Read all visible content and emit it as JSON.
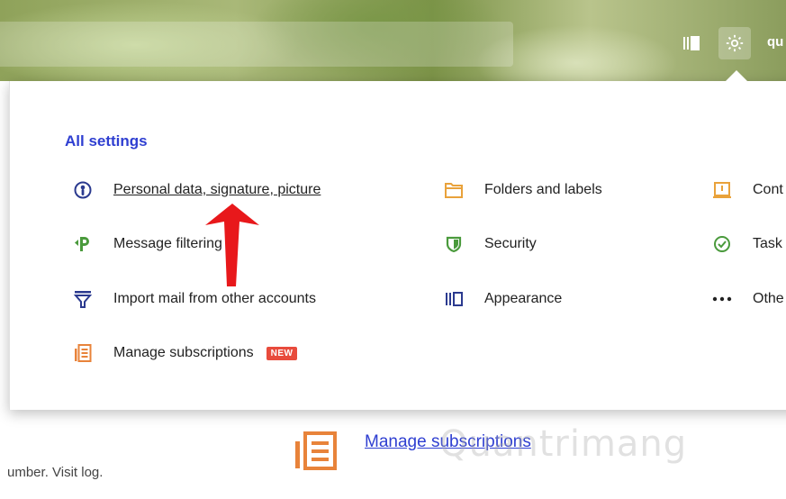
{
  "header": {
    "user_label": "qu"
  },
  "panel": {
    "title": "All settings",
    "items": [
      {
        "label": "Personal data, signature, picture",
        "icon": "person-circle-icon"
      },
      {
        "label": "Message filtering",
        "icon": "filter-p-icon"
      },
      {
        "label": "Import mail from other accounts",
        "icon": "import-funnel-icon"
      },
      {
        "label": "Manage subscriptions",
        "icon": "subscriptions-list-icon",
        "badge": "NEW"
      },
      {
        "label": "Folders and labels",
        "icon": "folder-icon"
      },
      {
        "label": "Security",
        "icon": "shield-icon"
      },
      {
        "label": "Appearance",
        "icon": "appearance-icon"
      },
      {
        "label": "Cont",
        "icon": "contacts-icon"
      },
      {
        "label": "Task",
        "icon": "check-circle-icon"
      },
      {
        "label": "Othe",
        "icon": "more-dots-icon"
      }
    ]
  },
  "background": {
    "subscriptions_link": "Manage subscriptions",
    "footer_text": "umber. Visit log."
  },
  "watermark": "Quantrimang",
  "colors": {
    "accent_blue": "#2f3fd1",
    "orange": "#e8833a",
    "green": "#4a9a3c",
    "badge_red": "#e84b3c"
  }
}
